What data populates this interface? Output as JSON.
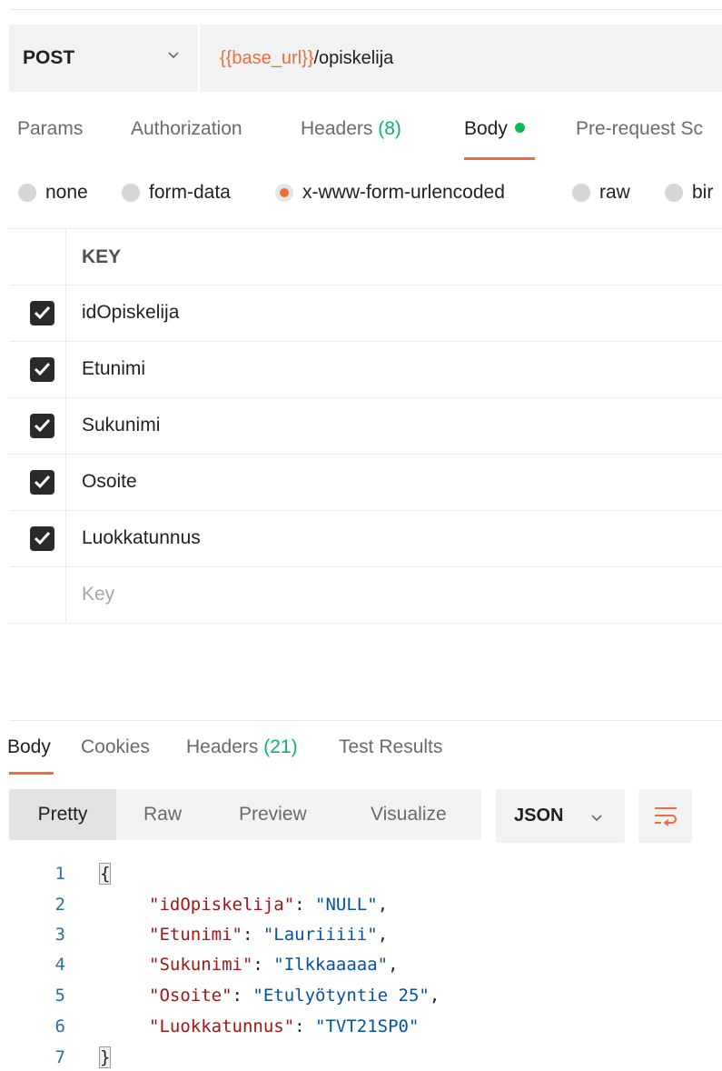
{
  "request": {
    "method": "POST",
    "url_variable": "{{base_url}}",
    "url_path": "/opiskelija"
  },
  "request_tabs": [
    {
      "label": "Params"
    },
    {
      "label": "Authorization"
    },
    {
      "label": "Headers",
      "count": "(8)"
    },
    {
      "label": "Body"
    },
    {
      "label": "Pre-request Sc"
    }
  ],
  "body_types": [
    {
      "label": "none",
      "selected": false
    },
    {
      "label": "form-data",
      "selected": false
    },
    {
      "label": "x-www-form-urlencoded",
      "selected": true
    },
    {
      "label": "raw",
      "selected": false
    },
    {
      "label": "bir",
      "selected": false
    }
  ],
  "kv_table": {
    "header": "KEY",
    "rows": [
      "idOpiskelija",
      "Etunimi",
      "Sukunimi",
      "Osoite",
      "Luokkatunnus"
    ],
    "placeholder": "Key"
  },
  "response_tabs": [
    {
      "label": "Body"
    },
    {
      "label": "Cookies"
    },
    {
      "label": "Headers",
      "count": "(21)"
    },
    {
      "label": "Test Results"
    }
  ],
  "view_modes": [
    "Pretty",
    "Raw",
    "Preview",
    "Visualize"
  ],
  "format": "JSON",
  "code": {
    "open": "{",
    "close": "}",
    "lines": [
      {
        "num": "1"
      },
      {
        "num": "2",
        "key": "\"idOpiskelija\"",
        "value": "\"NULL\"",
        "comma": ","
      },
      {
        "num": "3",
        "key": "\"Etunimi\"",
        "value": "\"Lauriiiii\"",
        "comma": ","
      },
      {
        "num": "4",
        "key": "\"Sukunimi\"",
        "value": "\"Ilkkaaaaa\"",
        "comma": ","
      },
      {
        "num": "5",
        "key": "\"Osoite\"",
        "value": "\"Etulyötyntie 25\"",
        "comma": ","
      },
      {
        "num": "6",
        "key": "\"Luokkatunnus\"",
        "value": "\"TVT21SP0\"",
        "comma": ""
      },
      {
        "num": "7"
      }
    ]
  },
  "colors": {
    "accent": "#f26b3a",
    "active_dot": "#0cbb52",
    "count": "#0cb269"
  }
}
